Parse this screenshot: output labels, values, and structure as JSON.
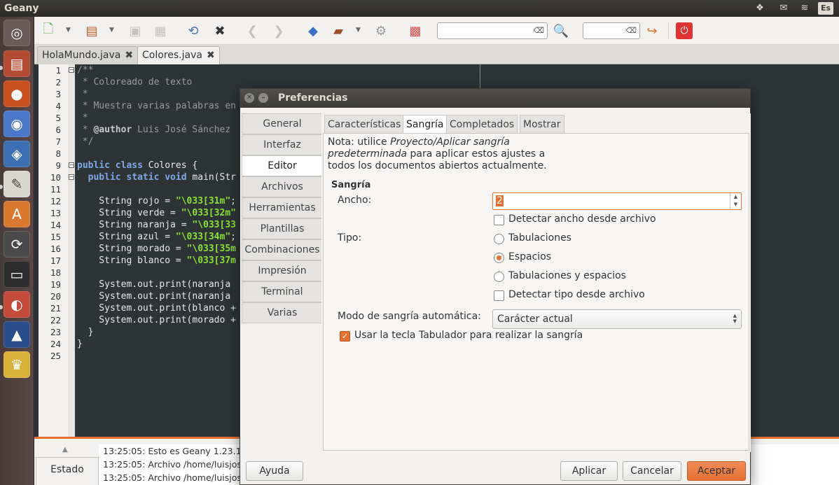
{
  "topbar": {
    "app_title": "Geany",
    "tray_icons": [
      "dropbox-icon",
      "mail-icon",
      "network-icon",
      "keyboard-layout-icon"
    ],
    "keyboard_layout": "Es"
  },
  "launcher": {
    "apps": [
      "ubuntu-dash-icon",
      "files-icon",
      "firefox-icon",
      "chromium-icon",
      "virtualbox-icon",
      "text-editor-icon",
      "software-center-icon",
      "software-updater-icon",
      "terminal-icon",
      "geany-app-icon",
      "inkscape-icon",
      "jester-icon"
    ]
  },
  "toolbar": {
    "icons": [
      "new-file-icon",
      "open-file-icon",
      "save-icon",
      "save-all-icon",
      "reload-icon",
      "close-file-icon",
      "back-icon",
      "forward-icon",
      "compile-icon",
      "build-icon",
      "execute-icon",
      "color-chooser-icon",
      "search-icon",
      "jump-to-line-icon",
      "quit-icon"
    ],
    "search_value": "",
    "goto_value": ""
  },
  "tabs": [
    {
      "label": "HolaMundo.java",
      "active": false
    },
    {
      "label": "Colores.java",
      "active": true
    }
  ],
  "editor": {
    "line_numbers": [
      "1",
      "2",
      "3",
      "4",
      "5",
      "6",
      "7",
      "8",
      "9",
      "10",
      "11",
      "12",
      "13",
      "14",
      "15",
      "16",
      "17",
      "18",
      "19",
      "20",
      "21",
      "22",
      "23",
      "24",
      "25"
    ],
    "lines": [
      [
        [
          "cm",
          "/**"
        ]
      ],
      [
        [
          "cm",
          " * Coloreado de texto"
        ]
      ],
      [
        [
          "cm",
          " *"
        ]
      ],
      [
        [
          "cm",
          " * Muestra varias palabras en"
        ]
      ],
      [
        [
          "cm",
          " *"
        ]
      ],
      [
        [
          "cm",
          " * "
        ],
        [
          "cmb",
          "@author"
        ],
        [
          "cm",
          " Luis José Sánchez"
        ]
      ],
      [
        [
          "cm",
          " */"
        ]
      ],
      [
        [
          "",
          ""
        ]
      ],
      [
        [
          "kw",
          "public class"
        ],
        [
          "",
          " Colores {"
        ]
      ],
      [
        [
          "",
          "  "
        ],
        [
          "kw",
          "public static void"
        ],
        [
          "",
          " main(Str"
        ]
      ],
      [
        [
          "",
          ""
        ]
      ],
      [
        [
          "",
          "    String rojo = "
        ],
        [
          "st",
          "\"\\033[31m\""
        ],
        [
          "",
          ";"
        ]
      ],
      [
        [
          "",
          "    String verde = "
        ],
        [
          "st",
          "\"\\033[32m\""
        ]
      ],
      [
        [
          "",
          "    String naranja = "
        ],
        [
          "st",
          "\"\\033[33"
        ]
      ],
      [
        [
          "",
          "    String azul = "
        ],
        [
          "st",
          "\"\\033[34m\""
        ],
        [
          "",
          ";"
        ]
      ],
      [
        [
          "",
          "    String morado = "
        ],
        [
          "st",
          "\"\\033[35m"
        ]
      ],
      [
        [
          "",
          "    String blanco = "
        ],
        [
          "st",
          "\"\\033[37m"
        ]
      ],
      [
        [
          "",
          ""
        ]
      ],
      [
        [
          "",
          "    System.out.print(naranja"
        ]
      ],
      [
        [
          "",
          "    System.out.print(naranja"
        ]
      ],
      [
        [
          "",
          "    System.out.print(blanco +"
        ]
      ],
      [
        [
          "",
          "    System.out.print(morado +"
        ]
      ],
      [
        [
          "",
          "  }"
        ]
      ],
      [
        [
          "",
          "}"
        ]
      ],
      [
        [
          "",
          ""
        ]
      ]
    ]
  },
  "bottom": {
    "tab_label": "Estado",
    "log": [
      "13:25:05: Esto es Geany 1.23.1.",
      "13:25:05: Archivo /home/luisjose",
      "13:25:05: Archivo /home/luisjos"
    ]
  },
  "dialog": {
    "title": "Preferencias",
    "side_tabs": [
      "General",
      "Interfaz",
      "Editor",
      "Archivos",
      "Herramientas",
      "Plantillas",
      "Combinaciones",
      "Impresión",
      "Terminal",
      "Varias"
    ],
    "active_side_tab": "Editor",
    "sub_tabs": [
      "Características",
      "Sangría",
      "Completados",
      "Mostrar"
    ],
    "active_sub_tab": "Sangría",
    "note_prefix": "Nota: utilice ",
    "note_italic_1": "Proyecto/Aplicar sangría",
    "note_italic_2": "predeterminada",
    "note_mid": " para aplicar estos ajustes a",
    "note_line3": "todos los documentos abiertos actualmente.",
    "section_title": "Sangría",
    "width_label": "Ancho:",
    "width_value": "2",
    "detect_width_label": "Detectar ancho desde archivo",
    "detect_width_checked": false,
    "type_label": "Tipo:",
    "type_options": [
      "Tabulaciones",
      "Espacios",
      "Tabulaciones y espacios"
    ],
    "type_selected": "Espacios",
    "detect_type_label": "Detectar tipo desde archivo",
    "detect_type_checked": false,
    "auto_mode_label": "Modo de sangría automática:",
    "auto_mode_value": "Carácter actual",
    "tab_key_label": "Usar la tecla Tabulador para realizar la sangría",
    "tab_key_checked": true,
    "help_button": "Ayuda",
    "apply_button": "Aplicar",
    "cancel_button": "Cancelar",
    "accept_button": "Aceptar"
  },
  "colors": {
    "accent": "#e57131",
    "editor_bg": "#2e3436",
    "string": "#8ae234",
    "keyword": "#7fa9e6"
  }
}
